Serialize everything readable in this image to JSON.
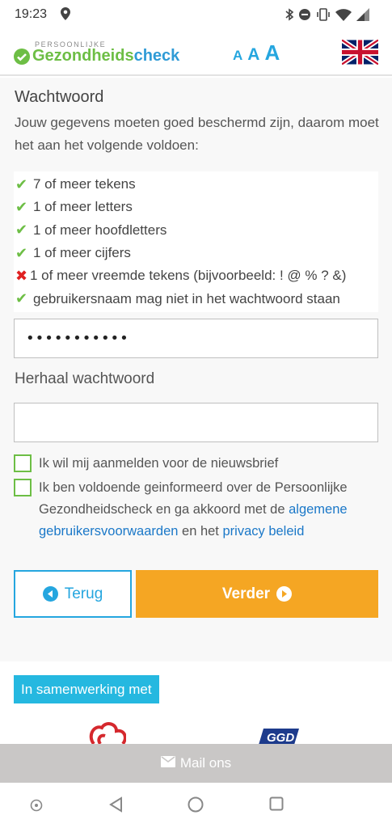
{
  "status": {
    "time": "19:23"
  },
  "header": {
    "logo_small": "PERSOONLIJKE",
    "logo_part1": "Gezondheids",
    "logo_part2": "check",
    "font_size_labels": [
      "A",
      "A",
      "A"
    ],
    "language_icon": "uk-flag-icon"
  },
  "form": {
    "section_title": "Wachtwoord",
    "intro": "Jouw gegevens moeten goed beschermd zijn, daarom moet het aan het volgende voldoen:",
    "rules": [
      {
        "label": "7 of meer tekens",
        "ok": true
      },
      {
        "label": "1 of meer letters",
        "ok": true
      },
      {
        "label": "1 of meer hoofdletters",
        "ok": true
      },
      {
        "label": "1 of meer cijfers",
        "ok": true
      },
      {
        "label": "1 of meer vreemde tekens (bijvoorbeeld: ! @ % ? &)",
        "ok": false
      },
      {
        "label": "gebruikersnaam mag niet in het wachtwoord staan",
        "ok": true
      }
    ],
    "password_value": "•••••••••••",
    "repeat_label": "Herhaal wachtwoord",
    "repeat_value": "",
    "newsletter_label": "Ik wil mij aanmelden voor de nieuwsbrief",
    "terms_text_1": "Ik ben voldoende geinformeerd over de Persoonlijke Gezondheidscheck en ga akkoord met de ",
    "terms_link_1": "algemene gebruikersvoorwaarden",
    "terms_text_2": " en het ",
    "terms_link_2": "privacy beleid"
  },
  "buttons": {
    "back_label": "Terug",
    "next_label": "Verder"
  },
  "cooperation": {
    "label": "In samenwerking met"
  },
  "footer": {
    "mail_label": "Mail ons"
  },
  "colors": {
    "green": "#6dbe45",
    "blue": "#25a6df",
    "orange": "#f5a623",
    "red": "#e02020",
    "link": "#1b78c8"
  }
}
